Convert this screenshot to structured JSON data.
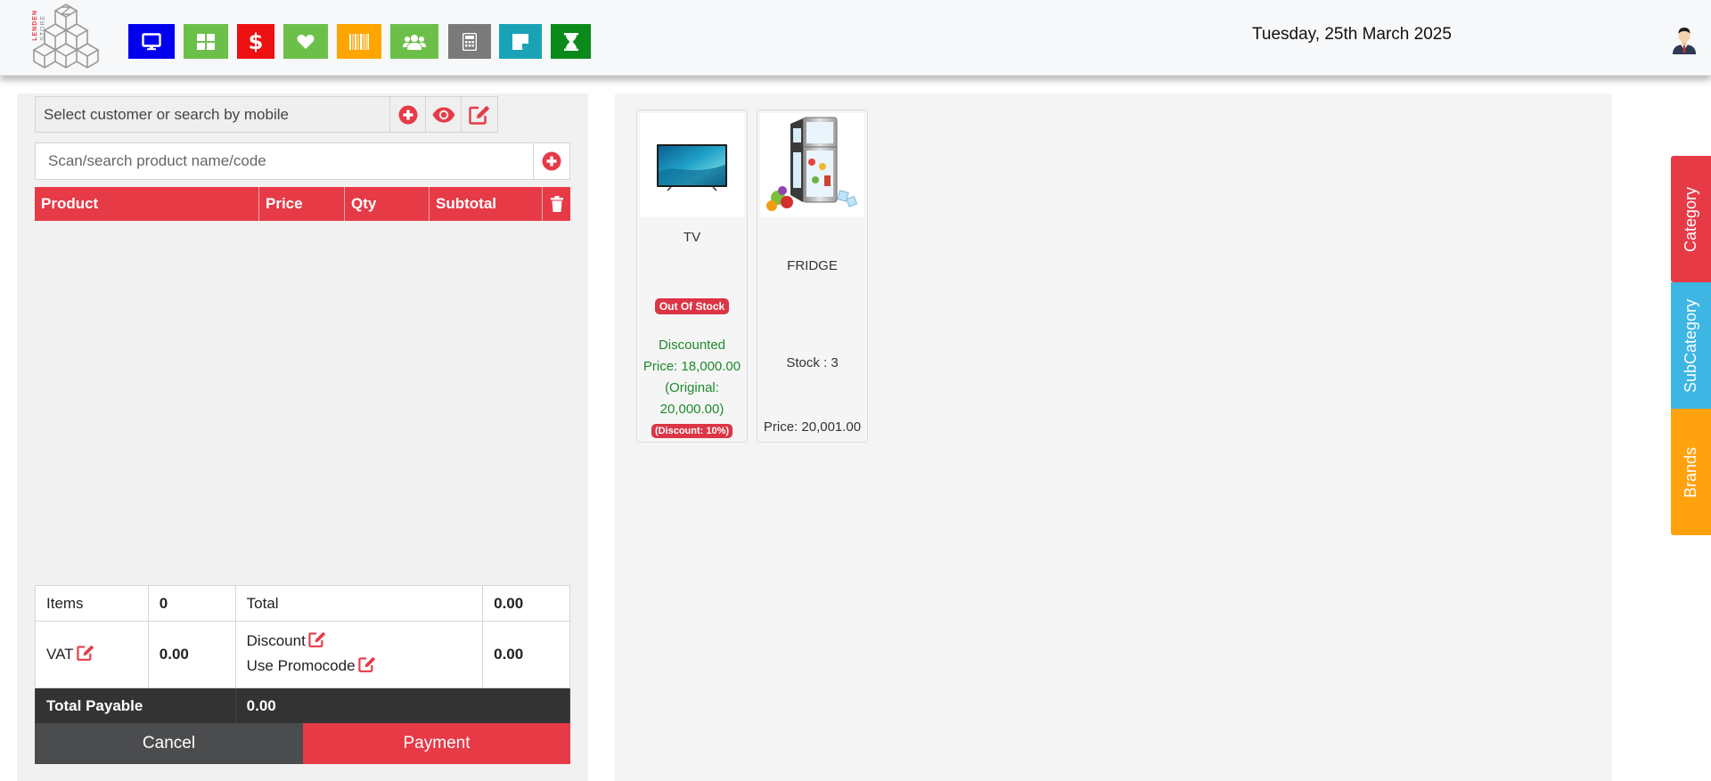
{
  "header": {
    "logo": {
      "brand": "LENDEN",
      "sub": "STORE"
    },
    "date": "Tuesday, 25th March 2025",
    "toolbar": [
      {
        "name": "pos-screen",
        "icon": "monitor-icon",
        "color": "#0000ee"
      },
      {
        "name": "dashboard",
        "icon": "grid-icon",
        "color": "#6cc04a"
      },
      {
        "name": "sales",
        "icon": "dollar-icon",
        "color": "#ee1111"
      },
      {
        "name": "favorites",
        "icon": "heart-icon",
        "color": "#6cc04a"
      },
      {
        "name": "barcode",
        "icon": "barcode-icon",
        "color": "#ffa500"
      },
      {
        "name": "customers",
        "icon": "users-icon",
        "color": "#6cc04a"
      },
      {
        "name": "calculator",
        "icon": "calculator-icon",
        "color": "#7a7a7a"
      },
      {
        "name": "notes",
        "icon": "sticky-note-icon",
        "color": "#1aa3b7"
      },
      {
        "name": "hold",
        "icon": "hourglass-icon",
        "color": "#0a8a1a"
      }
    ]
  },
  "customer": {
    "placeholder": "Select customer or search by mobile"
  },
  "product_search": {
    "placeholder": "Scan/search product name/code"
  },
  "cart": {
    "columns": [
      "Product",
      "Price",
      "Qty",
      "Subtotal"
    ],
    "rows": []
  },
  "totals": {
    "items_label": "Items",
    "items_value": "0",
    "total_label": "Total",
    "total_value": "0.00",
    "vat_label": "VAT",
    "vat_value": "0.00",
    "discount_label": "Discount",
    "promo_label": "Use Promocode",
    "discount_value": "0.00",
    "payable_label": "Total Payable",
    "payable_value": "0.00"
  },
  "actions": {
    "cancel": "Cancel",
    "payment": "Payment"
  },
  "products": [
    {
      "name": "TV",
      "stock_badge": "Out Of Stock",
      "discount_line1": "Discounted",
      "discount_line2": "Price: 18,000.00",
      "discount_line3": "(Original:",
      "discount_line4": "20,000.00)",
      "discount_badge": "(Discount: 10%)"
    },
    {
      "name": "FRIDGE",
      "stock": "Stock : 3",
      "price": "Price: 20,001.00"
    }
  ],
  "side_tabs": [
    {
      "label": "Category",
      "color": "#e63a47"
    },
    {
      "label": "SubCategory",
      "color": "#3db6e3"
    },
    {
      "label": "Brands",
      "color": "#ffa20e"
    }
  ]
}
